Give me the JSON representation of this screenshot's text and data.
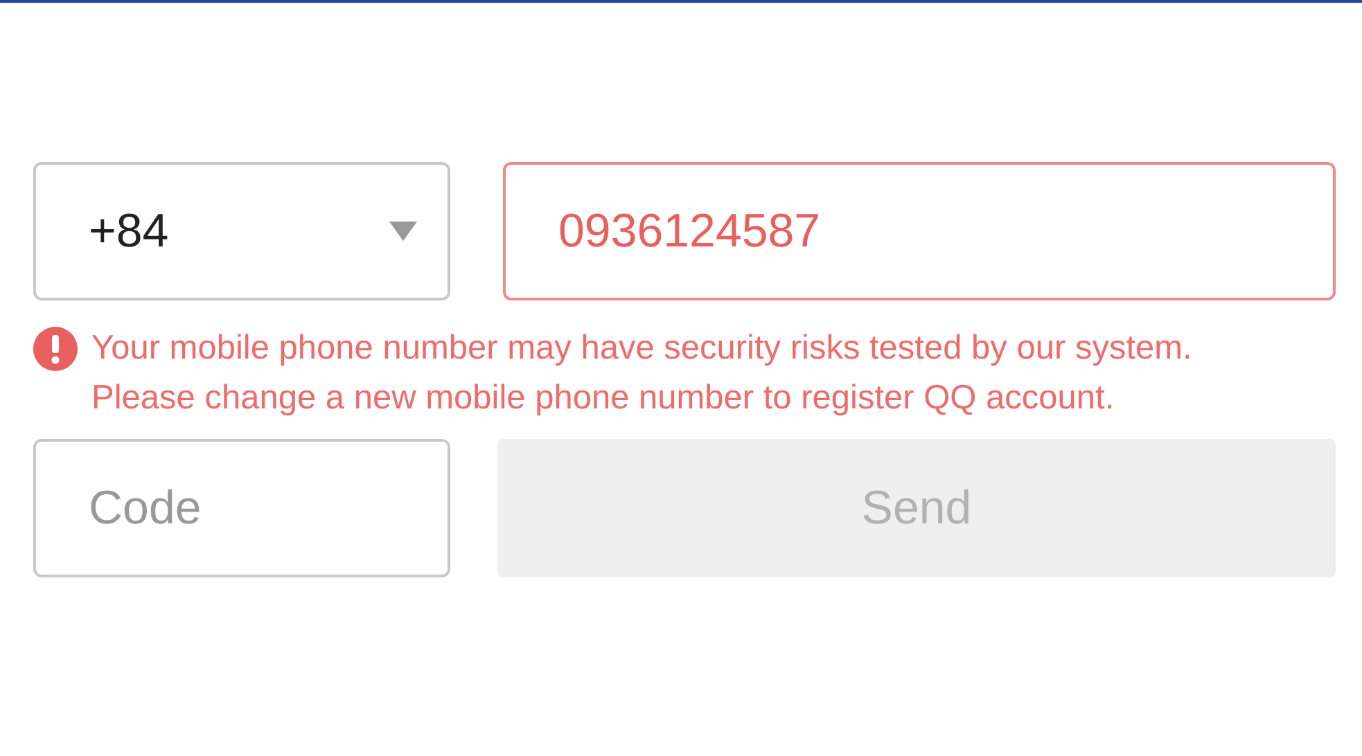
{
  "country_code": {
    "value": "+84"
  },
  "phone": {
    "value": "0936124587",
    "invalid": true
  },
  "error": {
    "lines": [
      "Your mobile phone number may have security risks tested by our system.",
      "Please change a new mobile phone number to register QQ account."
    ]
  },
  "code": {
    "placeholder": "Code"
  },
  "send_button": {
    "label": "Send",
    "disabled": true
  }
}
